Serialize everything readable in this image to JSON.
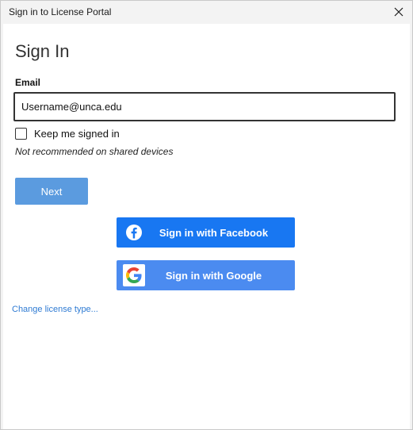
{
  "window": {
    "title": "Sign in to License Portal",
    "close_icon": "close-icon"
  },
  "form": {
    "heading": "Sign In",
    "email_label": "Email",
    "email_value": "Username@unca.edu",
    "keep_signed_in_label": "Keep me signed in",
    "keep_signed_in_checked": false,
    "hint": "Not recommended on shared devices",
    "next_label": "Next"
  },
  "social": {
    "facebook_label": "Sign in with Facebook",
    "facebook_icon": "facebook-icon",
    "facebook_color": "#1877f2",
    "google_label": "Sign in with Google",
    "google_icon": "google-icon",
    "google_color": "#4b8bf0"
  },
  "links": {
    "change_license": "Change license type..."
  },
  "colors": {
    "primary_button": "#5b9bdf",
    "link": "#2f7bd3"
  }
}
